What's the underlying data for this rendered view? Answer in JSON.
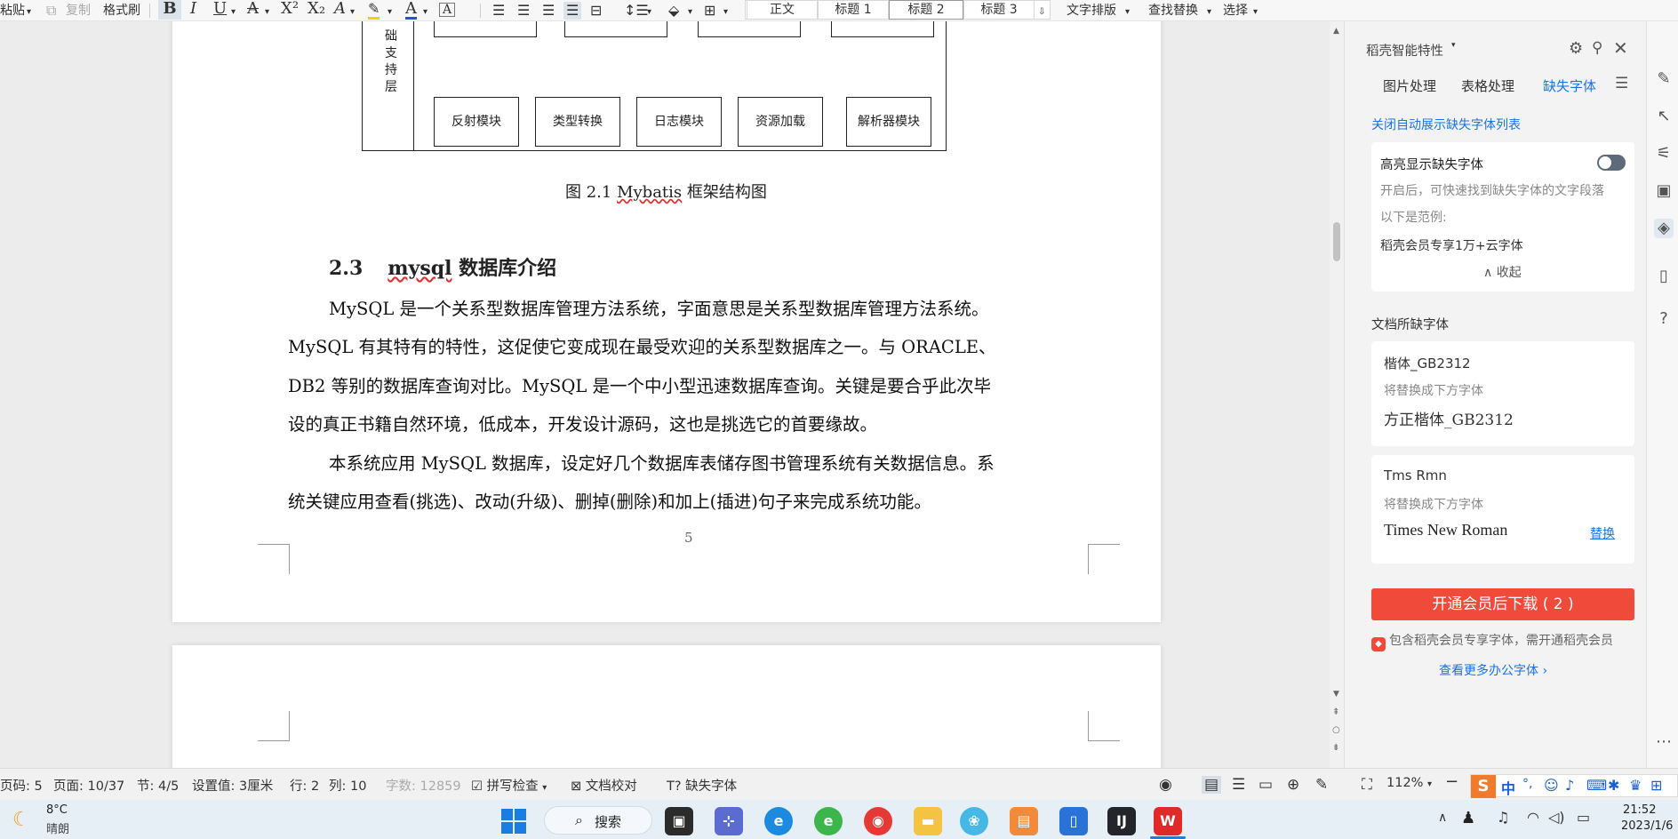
{
  "toolbar": {
    "paste": "粘贴",
    "copy": "复制",
    "format_painter": "格式刷",
    "bold": "B",
    "italic": "I",
    "underline": "U",
    "strike": "A",
    "superscript": "X²",
    "subscript": "X₂",
    "styles": [
      "正文",
      "标题 1",
      "标题 2",
      "标题 3"
    ],
    "text_layout": "文字排版",
    "find_replace": "查找替换",
    "select": "选择"
  },
  "document": {
    "diagram": {
      "side_label": "础支持层",
      "modules": [
        "反射模块",
        "类型转换",
        "日志模块",
        "资源加载",
        "解析器模块"
      ]
    },
    "figure_caption_prefix": "图 2.1 ",
    "figure_caption_word": "Mybatis",
    "figure_caption_suffix": " 框架结构图",
    "section_number": "2.3",
    "section_word": "mysql",
    "section_title": " 数据库介绍",
    "paragraph1_lines": [
      "MySQL 是一个关系型数据库管理方法系统，字面意思是关系型数据库管理方法系统。",
      "MySQL 有其特有的特性，这促使它变成现在最受欢迎的关系型数据库之一。与 ORACLE、",
      "DB2 等别的数据库查询对比。MySQL 是一个中小型迅速数据库查询。关键是要合乎此次毕",
      "设的真正书籍自然环境，低成本，开发设计源码，这也是挑选它的首要缘故。"
    ],
    "paragraph2_lines": [
      "本系统应用 MySQL 数据库，设定好几个数据库表储存图书管理系统有关数据信息。系",
      "统关键应用查看(挑选)、改动(升级)、删掉(删除)和加上(插进)句子来完成系统功能。"
    ],
    "page_number": "5"
  },
  "panel": {
    "title": "稻壳智能特性",
    "tabs": [
      "图片处理",
      "表格处理",
      "缺失字体"
    ],
    "close_auto_list": "关闭自动展示缺失字体列表",
    "highlight_title": "高亮显示缺失字体",
    "highlight_desc": "开启后，可快速找到缺失字体的文字段落",
    "example_label": "以下是范例:",
    "example_text": "稻壳会员专享1万+云字体",
    "collapse": "收起",
    "missing_section": "文档所缺字体",
    "fonts": [
      {
        "name": "楷体_GB2312",
        "replace_hint": "将替换成下方字体",
        "replacement": "方正楷体_GB2312",
        "action": ""
      },
      {
        "name": "Tms Rmn",
        "replace_hint": "将替换成下方字体",
        "replacement": "Times New Roman",
        "action": "替换"
      }
    ],
    "download_button": "开通会员后下载 ( 2 )",
    "member_note": "包含稻壳会员专享字体，需开通稻壳会员",
    "more_link": "查看更多办公字体"
  },
  "status": {
    "page_code": "页码: 5",
    "page": "页面: 10/37",
    "section": "节: 4/5",
    "setting": "设置值: 3厘米",
    "row": "行: 2",
    "col": "列: 10",
    "word_count": "字数: 12859",
    "spell_check": "拼写检查",
    "proofread": "文档校对",
    "missing_font": "缺失字体",
    "zoom": "112%"
  },
  "taskbar": {
    "temperature": "8°C",
    "weather": "晴朗",
    "search": "搜索",
    "time": "21:52",
    "date": "2023/1/6",
    "ime_lang": "中"
  },
  "colors": {
    "accent_blue": "#1a73e8",
    "download_red": "#f04a3a",
    "wps_red": "#e02a2a"
  }
}
